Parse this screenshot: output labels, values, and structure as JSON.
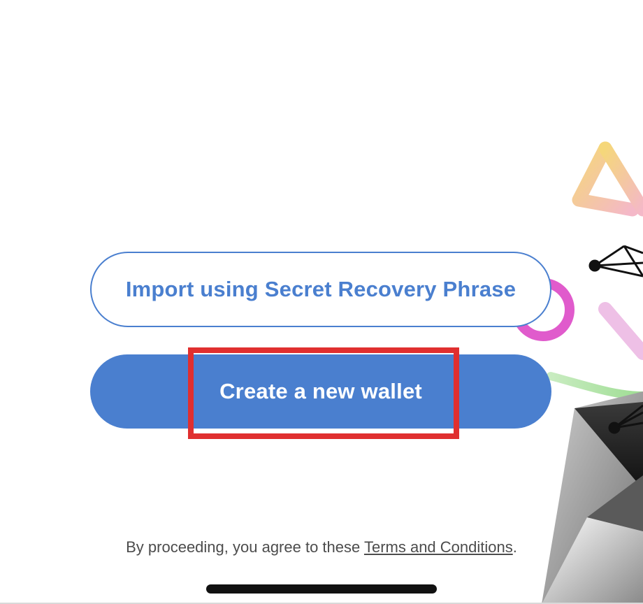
{
  "buttons": {
    "import_label": "Import using Secret Recovery Phrase",
    "create_label": "Create a new wallet"
  },
  "footer": {
    "prefix": "By proceeding, you agree to these ",
    "link_text": "Terms and Conditions",
    "suffix": "."
  },
  "colors": {
    "primary_blue": "#4a7fcf",
    "highlight_red": "#e02f2f",
    "text_gray": "#4c4c4c"
  }
}
